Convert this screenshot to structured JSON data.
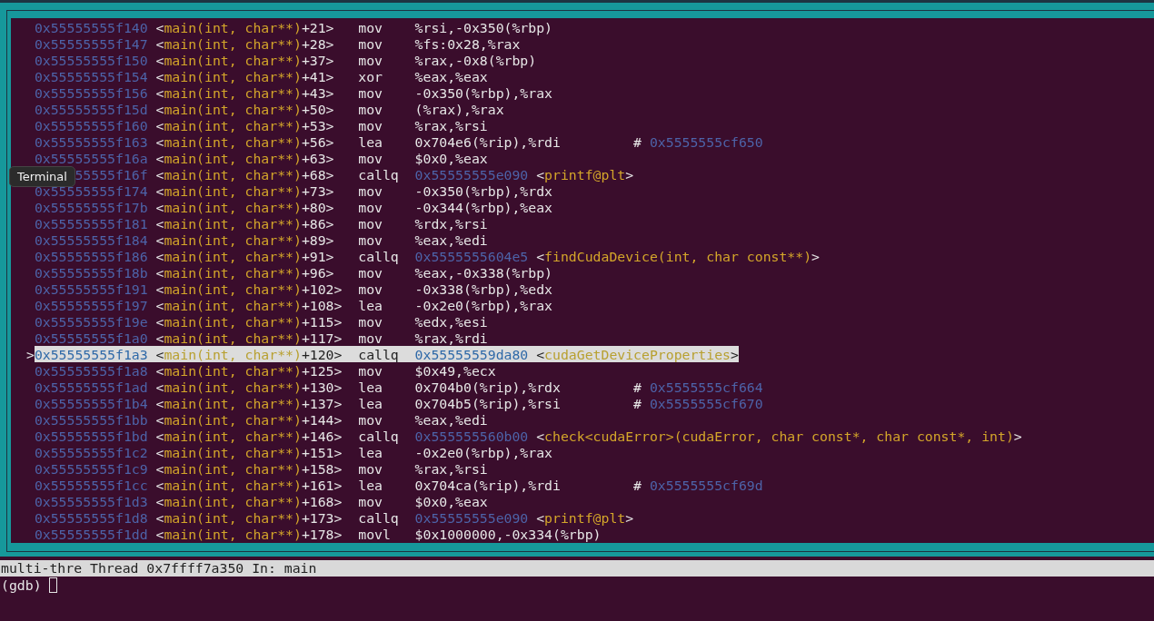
{
  "tooltip": {
    "label": "Terminal"
  },
  "rows": [
    {
      "address": "0x55555555f140",
      "function": "<main(int, char**)+21>",
      "mnemonic": "mov",
      "operands": "%rsi,-0x350(%rbp)",
      "selected": false
    },
    {
      "address": "0x55555555f147",
      "function": "<main(int, char**)+28>",
      "mnemonic": "mov",
      "operands": "%fs:0x28,%rax",
      "selected": false
    },
    {
      "address": "0x55555555f150",
      "function": "<main(int, char**)+37>",
      "mnemonic": "mov",
      "operands": "%rax,-0x8(%rbp)",
      "selected": false
    },
    {
      "address": "0x55555555f154",
      "function": "<main(int, char**)+41>",
      "mnemonic": "xor",
      "operands": "%eax,%eax",
      "selected": false
    },
    {
      "address": "0x55555555f156",
      "function": "<main(int, char**)+43>",
      "mnemonic": "mov",
      "operands": "-0x350(%rbp),%rax",
      "selected": false
    },
    {
      "address": "0x55555555f15d",
      "function": "<main(int, char**)+50>",
      "mnemonic": "mov",
      "operands": "(%rax),%rax",
      "selected": false
    },
    {
      "address": "0x55555555f160",
      "function": "<main(int, char**)+53>",
      "mnemonic": "mov",
      "operands": "%rax,%rsi",
      "selected": false
    },
    {
      "address": "0x55555555f163",
      "function": "<main(int, char**)+56>",
      "mnemonic": "lea",
      "operands": "0x704e6(%rip),%rdi",
      "comment": "#",
      "comment_address": "0x5555555cf650",
      "selected": false
    },
    {
      "address": "0x55555555f16a",
      "function": "<main(int, char**)+63>",
      "mnemonic": "mov",
      "operands": "$0x0,%eax",
      "selected": false
    },
    {
      "address": "55555f16f",
      "function": "<main(int, char**)+68>",
      "mnemonic": "callq",
      "target": "0x55555555e090",
      "symbol": "<printf@plt>",
      "selected": false
    },
    {
      "address": "0x55555555f174",
      "function": "<main(int, char**)+73>",
      "mnemonic": "mov",
      "operands": "-0x350(%rbp),%rdx",
      "selected": false
    },
    {
      "address": "0x55555555f17b",
      "function": "<main(int, char**)+80>",
      "mnemonic": "mov",
      "operands": "-0x344(%rbp),%eax",
      "selected": false
    },
    {
      "address": "0x55555555f181",
      "function": "<main(int, char**)+86>",
      "mnemonic": "mov",
      "operands": "%rdx,%rsi",
      "selected": false
    },
    {
      "address": "0x55555555f184",
      "function": "<main(int, char**)+89>",
      "mnemonic": "mov",
      "operands": "%eax,%edi",
      "selected": false
    },
    {
      "address": "0x55555555f186",
      "function": "<main(int, char**)+91>",
      "mnemonic": "callq",
      "target": "0x5555555604e5",
      "symbol": "<findCudaDevice(int, char const**)>",
      "selected": false
    },
    {
      "address": "0x55555555f18b",
      "function": "<main(int, char**)+96>",
      "mnemonic": "mov",
      "operands": "%eax,-0x338(%rbp)",
      "selected": false
    },
    {
      "address": "0x55555555f191",
      "function": "<main(int, char**)+102>",
      "mnemonic": "mov",
      "operands": "-0x338(%rbp),%edx",
      "selected": false
    },
    {
      "address": "0x55555555f197",
      "function": "<main(int, char**)+108>",
      "mnemonic": "lea",
      "operands": "-0x2e0(%rbp),%rax",
      "selected": false
    },
    {
      "address": "0x55555555f19e",
      "function": "<main(int, char**)+115>",
      "mnemonic": "mov",
      "operands": "%edx,%esi",
      "selected": false
    },
    {
      "address": "0x55555555f1a0",
      "function": "<main(int, char**)+117>",
      "mnemonic": "mov",
      "operands": "%rax,%rdi",
      "selected": false
    },
    {
      "address": "0x55555555f1a3",
      "function": "<main(int, char**)+120>",
      "mnemonic": "callq",
      "target": "0x55555559da80",
      "symbol": "<cudaGetDeviceProperties>",
      "selected": true,
      "marker": ">"
    },
    {
      "address": "0x55555555f1a8",
      "function": "<main(int, char**)+125>",
      "mnemonic": "mov",
      "operands": "$0x49,%ecx",
      "selected": false
    },
    {
      "address": "0x55555555f1ad",
      "function": "<main(int, char**)+130>",
      "mnemonic": "lea",
      "operands": "0x704b0(%rip),%rdx",
      "comment": "#",
      "comment_address": "0x5555555cf664",
      "selected": false
    },
    {
      "address": "0x55555555f1b4",
      "function": "<main(int, char**)+137>",
      "mnemonic": "lea",
      "operands": "0x704b5(%rip),%rsi",
      "comment": "#",
      "comment_address": "0x5555555cf670",
      "selected": false
    },
    {
      "address": "0x55555555f1bb",
      "function": "<main(int, char**)+144>",
      "mnemonic": "mov",
      "operands": "%eax,%edi",
      "selected": false
    },
    {
      "address": "0x55555555f1bd",
      "function": "<main(int, char**)+146>",
      "mnemonic": "callq",
      "target": "0x555555560b00",
      "symbol": "<check<cudaError>(cudaError, char const*, char const*, int)>",
      "selected": false
    },
    {
      "address": "0x55555555f1c2",
      "function": "<main(int, char**)+151>",
      "mnemonic": "lea",
      "operands": "-0x2e0(%rbp),%rax",
      "selected": false
    },
    {
      "address": "0x55555555f1c9",
      "function": "<main(int, char**)+158>",
      "mnemonic": "mov",
      "operands": "%rax,%rsi",
      "selected": false
    },
    {
      "address": "0x55555555f1cc",
      "function": "<main(int, char**)+161>",
      "mnemonic": "lea",
      "operands": "0x704ca(%rip),%rdi",
      "comment": "#",
      "comment_address": "0x5555555cf69d",
      "selected": false
    },
    {
      "address": "0x55555555f1d3",
      "function": "<main(int, char**)+168>",
      "mnemonic": "mov",
      "operands": "$0x0,%eax",
      "selected": false
    },
    {
      "address": "0x55555555f1d8",
      "function": "<main(int, char**)+173>",
      "mnemonic": "callq",
      "target": "0x55555555e090",
      "symbol": "<printf@plt>",
      "selected": false
    },
    {
      "address": "0x55555555f1dd",
      "function": "<main(int, char**)+178>",
      "mnemonic": "movl",
      "operands": "$0x1000000,-0x334(%rbp)",
      "selected": false
    }
  ],
  "status_bar": {
    "text": "multi-thre Thread 0x7ffff7a350 In: main"
  },
  "prompt": {
    "text": "(gdb)"
  }
}
